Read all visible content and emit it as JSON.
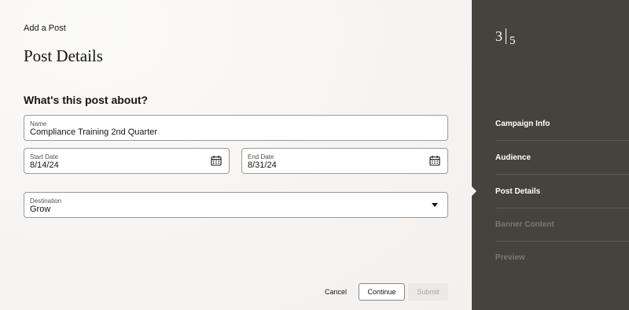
{
  "header": {
    "breadcrumb": "Add a Post",
    "title": "Post Details"
  },
  "form": {
    "section_title": "What's this post about?",
    "name": {
      "label": "Name",
      "value": "Compliance Training 2nd Quarter"
    },
    "start_date": {
      "label": "Start Date",
      "value": "8/14/24",
      "icon": "calendar-icon"
    },
    "end_date": {
      "label": "End Date",
      "value": "8/31/24",
      "icon": "calendar-icon"
    },
    "destination": {
      "label": "Destination",
      "value": "Grow",
      "icon": "chevron-down-icon"
    }
  },
  "actions": {
    "cancel": "Cancel",
    "continue": "Continue",
    "submit": "Submit"
  },
  "progress": {
    "current": "3",
    "total": "5",
    "steps": [
      {
        "label": "Campaign Info",
        "state": "done"
      },
      {
        "label": "Audience",
        "state": "done"
      },
      {
        "label": "Post Details",
        "state": "current"
      },
      {
        "label": "Banner Content",
        "state": "disabled"
      },
      {
        "label": "Preview",
        "state": "disabled"
      }
    ]
  },
  "colors": {
    "sidebar_bg": "#46433e",
    "page_bg": "#f7f5f3",
    "field_border": "#9e9a95"
  }
}
